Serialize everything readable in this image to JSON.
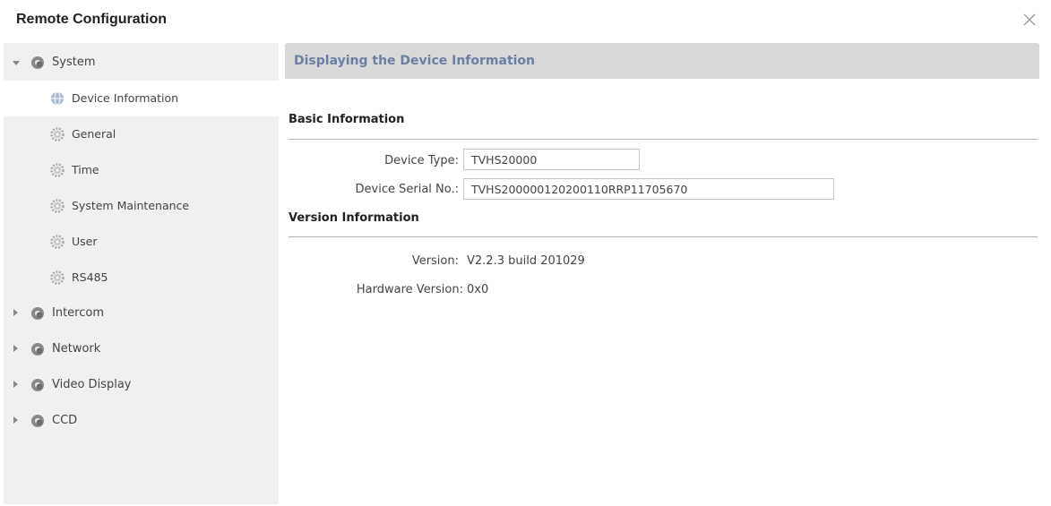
{
  "window": {
    "title": "Remote Configuration"
  },
  "sidebar": {
    "items": [
      {
        "label": "System",
        "expanded": true,
        "icon": "gear-cloud-icon"
      },
      {
        "label": "Device Information",
        "selected": true,
        "icon": "globe-icon"
      },
      {
        "label": "General",
        "icon": "gear-icon"
      },
      {
        "label": "Time",
        "icon": "gear-icon"
      },
      {
        "label": "System Maintenance",
        "icon": "gear-icon"
      },
      {
        "label": "User",
        "icon": "gear-icon"
      },
      {
        "label": "RS485",
        "icon": "gear-icon"
      },
      {
        "label": "Intercom",
        "expanded": false,
        "icon": "gear-cloud-icon"
      },
      {
        "label": "Network",
        "expanded": false,
        "icon": "gear-cloud-icon"
      },
      {
        "label": "Video Display",
        "expanded": false,
        "icon": "gear-cloud-icon"
      },
      {
        "label": "CCD",
        "expanded": false,
        "icon": "gear-cloud-icon"
      }
    ]
  },
  "main": {
    "header": "Displaying the Device Information",
    "basic": {
      "title": "Basic Information",
      "device_type_label": "Device Type:",
      "device_type_value": "TVHS20000",
      "serial_label": "Device Serial No.:",
      "serial_value": "TVHS200000120200110RRP11705670"
    },
    "version": {
      "title": "Version Information",
      "version_label": "Version:",
      "version_value": "V2.2.3 build 201029",
      "hardware_label": "Hardware Version:",
      "hardware_value": "0x0"
    }
  },
  "colors": {
    "sidebar_bg": "#f0f0f0",
    "header_bg": "#d9d9d9",
    "header_text": "#6b7fa0"
  }
}
